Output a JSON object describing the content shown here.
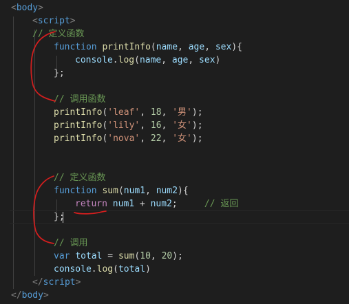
{
  "editor": {
    "lines": [
      [
        {
          "t": "<",
          "c": "punc"
        },
        {
          "t": "body",
          "c": "tag"
        },
        {
          "t": ">",
          "c": "punc"
        }
      ],
      [
        {
          "t": "<",
          "c": "punc"
        },
        {
          "t": "script",
          "c": "tag"
        },
        {
          "t": ">",
          "c": "punc"
        }
      ],
      [
        {
          "t": "// 定义函数",
          "c": "cmt"
        }
      ],
      [
        {
          "t": "function",
          "c": "kw"
        },
        {
          "t": " ",
          "c": "txt"
        },
        {
          "t": "printInfo",
          "c": "fn"
        },
        {
          "t": "(",
          "c": "txt"
        },
        {
          "t": "name",
          "c": "var"
        },
        {
          "t": ", ",
          "c": "txt"
        },
        {
          "t": "age",
          "c": "var"
        },
        {
          "t": ", ",
          "c": "txt"
        },
        {
          "t": "sex",
          "c": "var"
        },
        {
          "t": "){",
          "c": "txt"
        }
      ],
      [
        {
          "t": "console",
          "c": "var"
        },
        {
          "t": ".",
          "c": "txt"
        },
        {
          "t": "log",
          "c": "fn"
        },
        {
          "t": "(",
          "c": "txt"
        },
        {
          "t": "name",
          "c": "var"
        },
        {
          "t": ", ",
          "c": "txt"
        },
        {
          "t": "age",
          "c": "var"
        },
        {
          "t": ", ",
          "c": "txt"
        },
        {
          "t": "sex",
          "c": "var"
        },
        {
          "t": ")",
          "c": "txt"
        }
      ],
      [
        {
          "t": "};",
          "c": "txt"
        }
      ],
      [],
      [
        {
          "t": "// 调用函数",
          "c": "cmt"
        }
      ],
      [
        {
          "t": "printInfo",
          "c": "fn"
        },
        {
          "t": "(",
          "c": "txt"
        },
        {
          "t": "'leaf'",
          "c": "str"
        },
        {
          "t": ", ",
          "c": "txt"
        },
        {
          "t": "18",
          "c": "num"
        },
        {
          "t": ", ",
          "c": "txt"
        },
        {
          "t": "'男'",
          "c": "str"
        },
        {
          "t": ");",
          "c": "txt"
        }
      ],
      [
        {
          "t": "printInfo",
          "c": "fn"
        },
        {
          "t": "(",
          "c": "txt"
        },
        {
          "t": "'lily'",
          "c": "str"
        },
        {
          "t": ", ",
          "c": "txt"
        },
        {
          "t": "16",
          "c": "num"
        },
        {
          "t": ", ",
          "c": "txt"
        },
        {
          "t": "'女'",
          "c": "str"
        },
        {
          "t": ");",
          "c": "txt"
        }
      ],
      [
        {
          "t": "printInfo",
          "c": "fn"
        },
        {
          "t": "(",
          "c": "txt"
        },
        {
          "t": "'nova'",
          "c": "str"
        },
        {
          "t": ", ",
          "c": "txt"
        },
        {
          "t": "22",
          "c": "num"
        },
        {
          "t": ", ",
          "c": "txt"
        },
        {
          "t": "'女'",
          "c": "str"
        },
        {
          "t": ");",
          "c": "txt"
        }
      ],
      [],
      [],
      [
        {
          "t": "// 定义函数",
          "c": "cmt"
        }
      ],
      [
        {
          "t": "function",
          "c": "kw"
        },
        {
          "t": " ",
          "c": "txt"
        },
        {
          "t": "sum",
          "c": "fn"
        },
        {
          "t": "(",
          "c": "txt"
        },
        {
          "t": "num1",
          "c": "var"
        },
        {
          "t": ", ",
          "c": "txt"
        },
        {
          "t": "num2",
          "c": "var"
        },
        {
          "t": "){",
          "c": "txt"
        }
      ],
      [
        {
          "t": "return",
          "c": "ctl"
        },
        {
          "t": " ",
          "c": "txt"
        },
        {
          "t": "num1",
          "c": "var"
        },
        {
          "t": " + ",
          "c": "txt"
        },
        {
          "t": "num2",
          "c": "var"
        },
        {
          "t": ";",
          "c": "txt"
        },
        {
          "t": "     ",
          "c": "txt"
        },
        {
          "t": "// 返回",
          "c": "cmt"
        }
      ],
      [
        {
          "t": "};",
          "c": "txt"
        }
      ],
      [],
      [
        {
          "t": "// 调用",
          "c": "cmt"
        }
      ],
      [
        {
          "t": "var",
          "c": "kw"
        },
        {
          "t": " ",
          "c": "txt"
        },
        {
          "t": "total",
          "c": "var"
        },
        {
          "t": " = ",
          "c": "txt"
        },
        {
          "t": "sum",
          "c": "fn"
        },
        {
          "t": "(",
          "c": "txt"
        },
        {
          "t": "10",
          "c": "num"
        },
        {
          "t": ", ",
          "c": "txt"
        },
        {
          "t": "20",
          "c": "num"
        },
        {
          "t": ");",
          "c": "txt"
        }
      ],
      [
        {
          "t": "console",
          "c": "var"
        },
        {
          "t": ".",
          "c": "txt"
        },
        {
          "t": "log",
          "c": "fn"
        },
        {
          "t": "(",
          "c": "txt"
        },
        {
          "t": "total",
          "c": "var"
        },
        {
          "t": ")",
          "c": "txt"
        }
      ],
      [
        {
          "t": "</",
          "c": "punc"
        },
        {
          "t": "script",
          "c": "tag"
        },
        {
          "t": ">",
          "c": "punc"
        }
      ],
      [
        {
          "t": "</",
          "c": "punc"
        },
        {
          "t": "body",
          "c": "tag"
        },
        {
          "t": ">",
          "c": "punc"
        }
      ]
    ],
    "current_line": 16
  },
  "colors": {
    "background": "#1e1e1e",
    "tag": "#569cd6",
    "keyword": "#569cd6",
    "control_keyword": "#c586c0",
    "function": "#dcdcaa",
    "variable": "#9cdcfe",
    "string": "#ce9178",
    "number": "#b5cea8",
    "comment": "#6a9955",
    "ink_annotation": "#d41e1e"
  }
}
